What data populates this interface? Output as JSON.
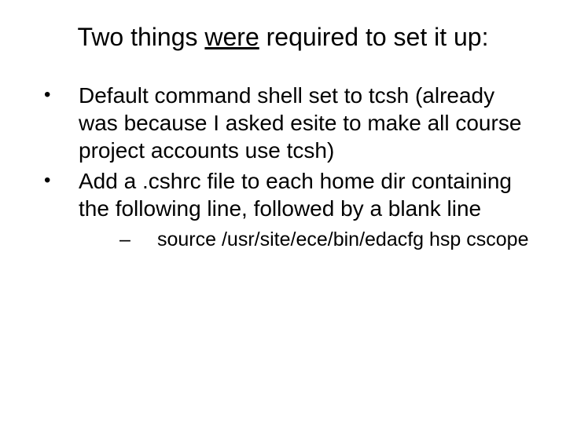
{
  "title_pre": "Two things ",
  "title_underline": "were",
  "title_post": " required to set it up:",
  "bullets": [
    "Default command shell set to tcsh (already was because I asked esite to make all course project accounts use tcsh)",
    "Add a .cshrc file to each home dir containing the following line, followed by a blank line"
  ],
  "sub_bullet": "source /usr/site/ece/bin/edacfg hsp cscope"
}
